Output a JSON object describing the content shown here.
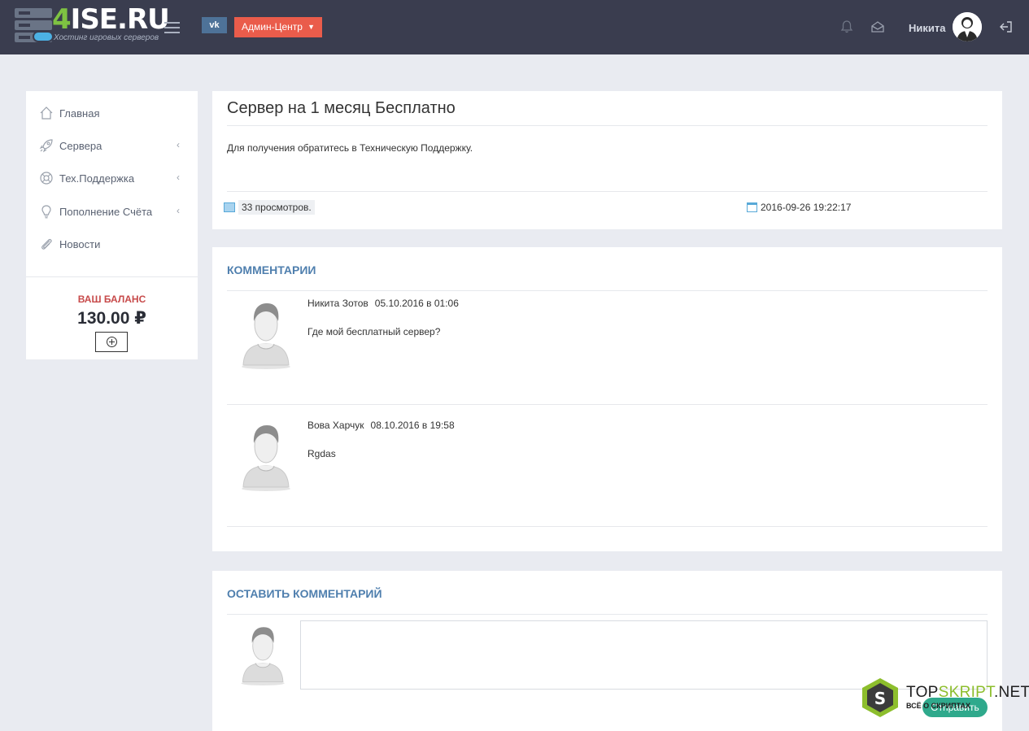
{
  "header": {
    "logo_title_accent": "4",
    "logo_title_rest": "ISE.RU",
    "logo_subtitle": "Хостинг игровых серверов",
    "vk_label": "vk",
    "admin_button": "Админ-Центр",
    "user_name": "Никита",
    "icons": [
      "menu-icon",
      "bell-icon",
      "mail-icon",
      "logout-icon"
    ]
  },
  "sidebar": {
    "items": [
      {
        "label": "Главная",
        "icon": "home-icon",
        "has_submenu": false
      },
      {
        "label": "Сервера",
        "icon": "rocket-icon",
        "has_submenu": true
      },
      {
        "label": "Тех.Поддержка",
        "icon": "lifebuoy-icon",
        "has_submenu": true
      },
      {
        "label": "Пополнение Счёта",
        "icon": "lightbulb-icon",
        "has_submenu": true
      },
      {
        "label": "Новости",
        "icon": "paperclip-icon",
        "has_submenu": false
      }
    ],
    "chevron": "‹",
    "balance_title": "ВАШ БАЛАНС",
    "balance_value": "130.00 ₽"
  },
  "news": {
    "title": "Сервер на 1 месяц Бесплатно",
    "body": "Для получения обратитесь в Техническую Поддержку.",
    "views": "33 просмотров.",
    "date": "2016-09-26 19:22:17"
  },
  "comments": {
    "title": "КОММЕНТАРИИ",
    "items": [
      {
        "author": "Никита Зотов",
        "date": "05.10.2016 в 01:06",
        "text": "Где мой бесплатный сервер?"
      },
      {
        "author": "Вова Харчук",
        "date": "08.10.2016 в 19:58",
        "text": "Rgdas"
      }
    ]
  },
  "leave_comment": {
    "title": "ОСТАВИТЬ КОММЕНТАРИЙ",
    "input_value": "",
    "submit_label": "Отправить"
  },
  "watermark": {
    "logo_letter": "S",
    "title_a": "TOP",
    "title_b": "SKRIPT",
    "title_c": ".NET",
    "subtitle": "ВСЁ О СКРИПТАХ"
  },
  "colors": {
    "header_bg": "#3a3d4f",
    "page_bg": "#e9ebf1",
    "admin_button": "#ea5c4b",
    "vk_button": "#4e7298",
    "section_title": "#4f7fae",
    "balance_title": "#c74a4a",
    "submit_button": "#2fa98c",
    "logo_green": "#7ec242"
  }
}
